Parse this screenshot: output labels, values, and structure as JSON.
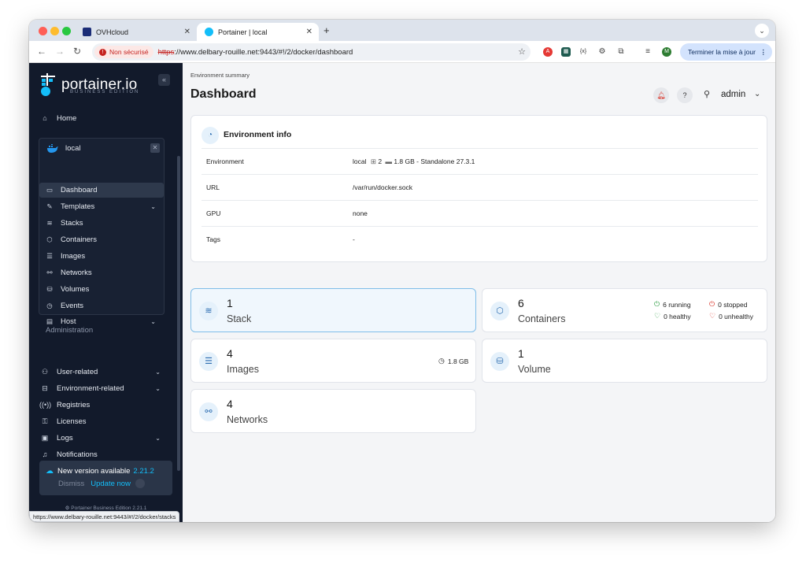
{
  "browser": {
    "tabs": [
      {
        "title": "OVHcloud",
        "active": false
      },
      {
        "title": "Portainer | local",
        "active": true
      }
    ],
    "new_tab": "+",
    "security_label": "Non sécurisé",
    "url_scheme": "https",
    "url_rest": "://www.delbary-rouille.net:9443/#!/2/docker/dashboard",
    "profile_initial": "M",
    "update_button": "Terminer la mise à jour",
    "status_url": "https://www.delbary-rouille.net:9443/#!/2/docker/stacks"
  },
  "sidebar": {
    "logo": "portainer.io",
    "logo_sub": "BUSINESS EDITION",
    "home": "Home",
    "environment": {
      "name": "local",
      "items": [
        {
          "label": "Dashboard",
          "icon": "dashboard-icon",
          "active": true
        },
        {
          "label": "Templates",
          "icon": "edit-icon",
          "expandable": true
        },
        {
          "label": "Stacks",
          "icon": "layers-icon"
        },
        {
          "label": "Containers",
          "icon": "box-icon"
        },
        {
          "label": "Images",
          "icon": "list-icon"
        },
        {
          "label": "Networks",
          "icon": "network-icon"
        },
        {
          "label": "Volumes",
          "icon": "database-icon"
        },
        {
          "label": "Events",
          "icon": "clock-icon"
        },
        {
          "label": "Host",
          "icon": "server-icon",
          "expandable": true
        }
      ]
    },
    "administration_label": "Administration",
    "admin_items": [
      {
        "label": "User-related",
        "icon": "users-icon",
        "expandable": true
      },
      {
        "label": "Environment-related",
        "icon": "hdd-icon",
        "expandable": true
      },
      {
        "label": "Registries",
        "icon": "radio-icon"
      },
      {
        "label": "Licenses",
        "icon": "key-icon"
      },
      {
        "label": "Logs",
        "icon": "file-icon",
        "expandable": true
      },
      {
        "label": "Notifications",
        "icon": "bell-icon"
      }
    ],
    "new_version": {
      "label": "New version available",
      "version": "2.21.2",
      "dismiss": "Dismiss",
      "update": "Update now"
    },
    "footer": "Portainer Business Edition 2.21.1"
  },
  "main": {
    "breadcrumb": "Environment summary",
    "title": "Dashboard",
    "user": "admin",
    "env_info": {
      "title": "Environment info",
      "rows": [
        {
          "key": "Environment",
          "value": "local",
          "cpu": "2",
          "mem": "1.8 GB - Standalone 27.3.1"
        },
        {
          "key": "URL",
          "value": "/var/run/docker.sock"
        },
        {
          "key": "GPU",
          "value": "none"
        },
        {
          "key": "Tags",
          "value": "-"
        }
      ]
    },
    "stats": {
      "stack": {
        "count": "1",
        "label": "Stack"
      },
      "containers": {
        "count": "6",
        "label": "Containers",
        "running": "6 running",
        "stopped": "0 stopped",
        "healthy": "0 healthy",
        "unhealthy": "0 unhealthy"
      },
      "images": {
        "count": "4",
        "label": "Images",
        "size": "1.8 GB"
      },
      "volume": {
        "count": "1",
        "label": "Volume"
      },
      "networks": {
        "count": "4",
        "label": "Networks"
      }
    }
  },
  "colors": {
    "sidebar_bg": "#121a2b",
    "accent_blue": "#2b6cb0",
    "running_green": "#2e9e44",
    "stopped_red": "#d93025"
  }
}
